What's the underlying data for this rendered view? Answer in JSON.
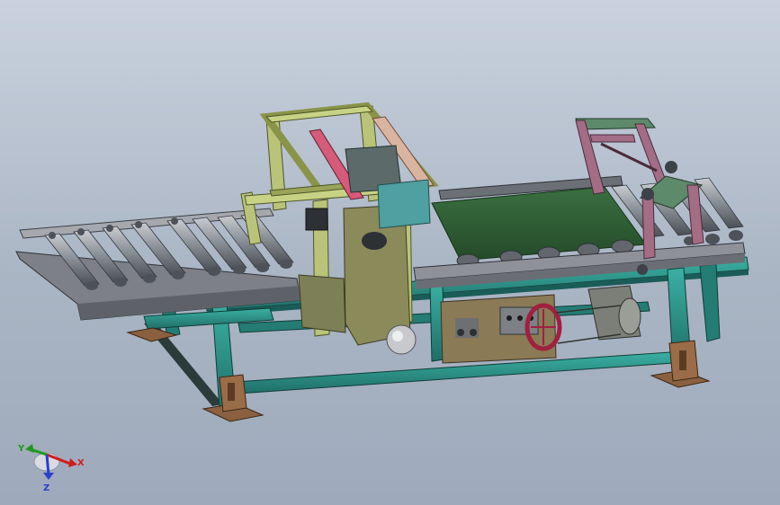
{
  "triad": {
    "x_label": "X",
    "y_label": "Y",
    "z_label": "Z"
  },
  "colors": {
    "frame": "#2f9a8f",
    "frame_dark": "#1f6e68",
    "roller": "#8d939a",
    "roller_end": "#4d5258",
    "conveyor_rail": "#6e7278",
    "belt": "#2f5f32",
    "sanding_frame": "#b9c47a",
    "tension_arm": "#a36d86",
    "foot_plate": "#8a6040",
    "control_box": "#8a7a55",
    "motor": "#7b7f77",
    "x_axis": "#d21c1c",
    "y_axis": "#1d9a1d",
    "z_axis": "#2a3fd0"
  }
}
